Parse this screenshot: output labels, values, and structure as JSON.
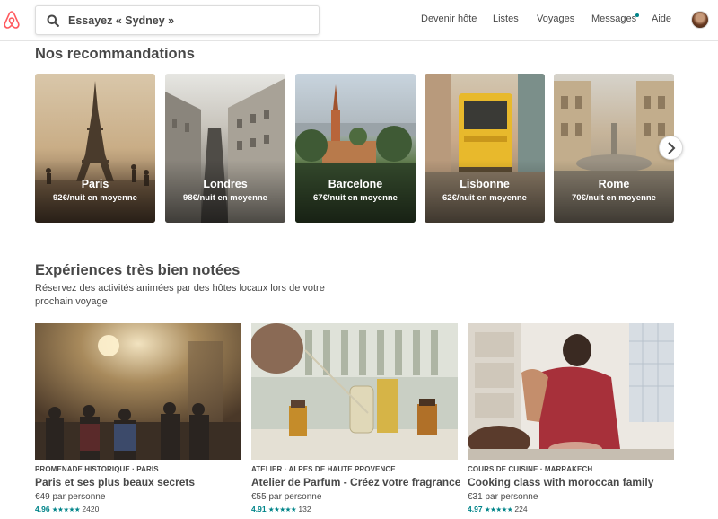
{
  "header": {
    "logo": "airbnb-logo",
    "search_placeholder": "Essayez « Sydney »",
    "nav": {
      "host": "Devenir hôte",
      "lists": "Listes",
      "trips": "Voyages",
      "messages": "Messages",
      "help": "Aide"
    }
  },
  "recommendations": {
    "title": "Nos recommandations",
    "cities": [
      {
        "name": "Paris",
        "price": "92€/nuit en moyenne"
      },
      {
        "name": "Londres",
        "price": "98€/nuit en moyenne"
      },
      {
        "name": "Barcelone",
        "price": "67€/nuit en moyenne"
      },
      {
        "name": "Lisbonne",
        "price": "62€/nuit en moyenne"
      },
      {
        "name": "Rome",
        "price": "70€/nuit en moyenne"
      }
    ],
    "next_icon": "chevron-right-icon"
  },
  "experiences": {
    "title": "Expériences très bien notées",
    "subtitle": "Réservez des activités animées par des hôtes locaux lors de votre prochain voyage",
    "items": [
      {
        "category": "PROMENADE HISTORIQUE · PARIS",
        "title": "Paris et ses plus beaux secrets",
        "price": "€49 par personne",
        "rating": "4.96",
        "stars": "★★★★★",
        "reviews": "2420"
      },
      {
        "category": "ATELIER · ALPES DE HAUTE PROVENCE",
        "title": "Atelier de Parfum - Créez votre fragrance",
        "price": "€55 par personne",
        "rating": "4.91",
        "stars": "★★★★★",
        "reviews": "132"
      },
      {
        "category": "COURS DE CUISINE · MARRAKECH",
        "title": "Cooking class with moroccan family",
        "price": "€31 par personne",
        "rating": "4.97",
        "stars": "★★★★★",
        "reviews": "224"
      }
    ]
  },
  "colors": {
    "brand": "#FF5A5F",
    "accent": "#008489",
    "text": "#484848"
  }
}
